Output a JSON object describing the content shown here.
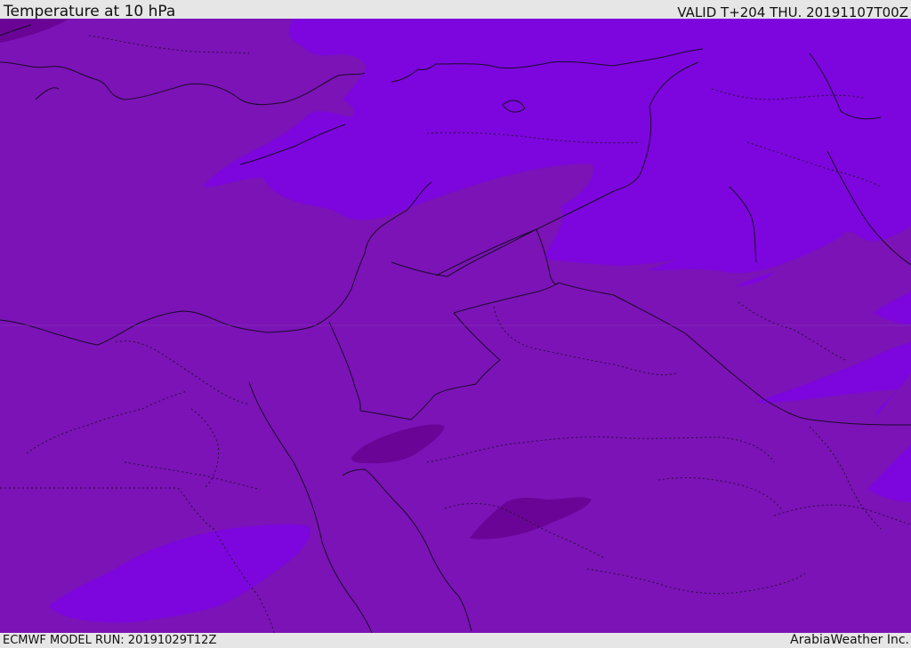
{
  "header": {
    "title": "Temperature at 10 hPa",
    "valid": "VALID T+204 THU. 20191107T00Z"
  },
  "footer": {
    "model_run": "ECMWF MODEL RUN: 20191029T12Z",
    "credit": "ArabiaWeather Inc."
  },
  "map": {
    "colors": {
      "base_fill": "#7b13b6",
      "warm_fill": "#7c06dd",
      "cold_fill": "#6a0496",
      "coast": "#1a0a2a"
    }
  }
}
